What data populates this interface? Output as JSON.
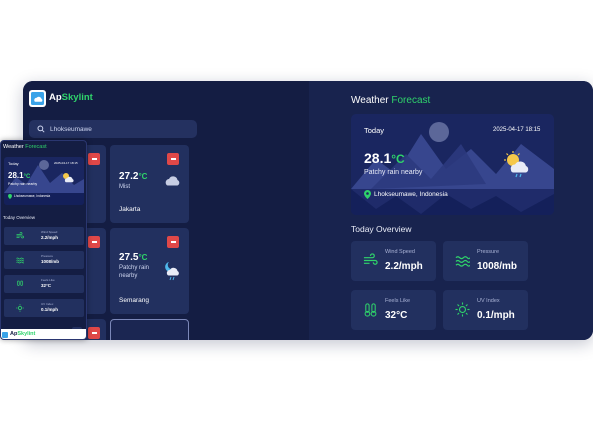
{
  "app": {
    "brand_prefix": "Ap",
    "brand_suffix": "Skylint",
    "search_placeholder": "Lhokseumawe"
  },
  "cards": [
    {
      "temp": "27.2",
      "unit": "°C",
      "condition": "Mist",
      "city": "Jakarta",
      "icon": "cloud-icon"
    },
    {
      "temp": "27.5",
      "unit": "°C",
      "condition": "Patchy rain nearby",
      "city": "Semarang",
      "icon": "moon-rain-icon"
    }
  ],
  "forecast": {
    "title_prefix": "Weather ",
    "title_suffix": "Forecast",
    "today_label": "Today",
    "datetime": "2025-04-17 18:15",
    "temp": "28.1",
    "unit": "°C",
    "condition": "Patchy rain nearby",
    "location": "Lhokseumawe, Indonesia",
    "overview_title": "Today Overview"
  },
  "metrics": [
    {
      "label": "Wind Speed",
      "value": "2.2/mph",
      "icon": "wind-icon"
    },
    {
      "label": "Pressure",
      "value": "1008/mb",
      "icon": "waves-icon"
    },
    {
      "label": "Feels Like",
      "value": "32°C",
      "icon": "thermometer-icon"
    },
    {
      "label": "UV Index",
      "value": "0.1/mph",
      "icon": "sun-icon"
    }
  ],
  "mobile": {
    "title_prefix": "Weather ",
    "title_suffix": "Forecast",
    "today_label": "Today",
    "datetime": "2025-04-17 18:15",
    "temp": "28.1",
    "unit": "°C",
    "condition": "Patchy rain nearby",
    "location": "Lhokseumawe, Indonesia",
    "overview_title": "Today Overview",
    "bottom_brand_prefix": "Ap",
    "bottom_brand_suffix": "Skylint"
  },
  "colors": {
    "accent_green": "#2fd36b",
    "background": "#141d43",
    "card": "#22305f",
    "delete_red": "#e04848"
  }
}
